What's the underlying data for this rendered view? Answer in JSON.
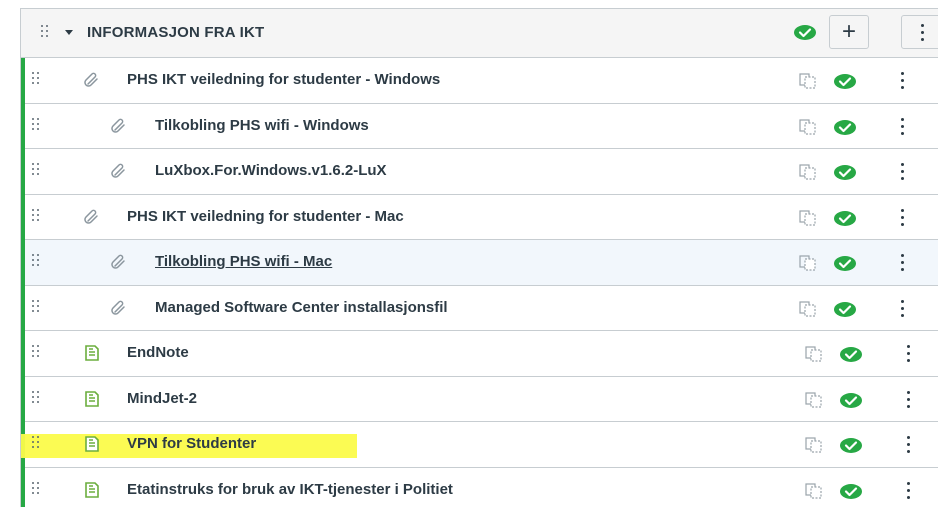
{
  "module": {
    "title": "INFORMASJON FRA IKT",
    "add_label": "+",
    "published": true
  },
  "items": [
    {
      "title": "PHS IKT veiledning for studenter - Windows",
      "type": "link",
      "indent": 0,
      "published": true,
      "link": false,
      "selected": false,
      "highlighted": false
    },
    {
      "title": "Tilkobling PHS wifi - Windows",
      "type": "link",
      "indent": 1,
      "published": true,
      "link": false,
      "selected": false,
      "highlighted": false
    },
    {
      "title": "LuXbox.For.Windows.v1.6.2-LuX",
      "type": "link",
      "indent": 1,
      "published": true,
      "link": false,
      "selected": false,
      "highlighted": false
    },
    {
      "title": "PHS IKT veiledning for studenter - Mac",
      "type": "link",
      "indent": 0,
      "published": true,
      "link": false,
      "selected": false,
      "highlighted": false
    },
    {
      "title": "Tilkobling PHS wifi - Mac",
      "type": "link",
      "indent": 1,
      "published": true,
      "link": true,
      "selected": true,
      "highlighted": false
    },
    {
      "title": "Managed Software Center installasjonsfil",
      "type": "link",
      "indent": 1,
      "published": true,
      "link": false,
      "selected": false,
      "highlighted": false
    },
    {
      "title": "EndNote",
      "type": "page",
      "indent": 0,
      "published": true,
      "link": false,
      "selected": false,
      "highlighted": false
    },
    {
      "title": "MindJet-2",
      "type": "page",
      "indent": 0,
      "published": true,
      "link": false,
      "selected": false,
      "highlighted": false
    },
    {
      "title": "VPN for Studenter",
      "type": "page",
      "indent": 0,
      "published": true,
      "link": false,
      "selected": false,
      "highlighted": true
    },
    {
      "title": "Etatinstruks for bruk av IKT-tjenester i Politiet",
      "type": "page",
      "indent": 0,
      "published": true,
      "link": false,
      "selected": false,
      "highlighted": false
    }
  ],
  "icons": {
    "drag": "drag-handle-icon",
    "link": "paperclip-icon",
    "page": "document-icon",
    "copy": "duplicate-icon",
    "published": "check-circle-icon",
    "menu": "kebab-menu-icon"
  },
  "colors": {
    "published_green": "#27a845",
    "page_icon_green": "#6cae3e",
    "highlight_yellow": "#fbfb4a",
    "selected_row": "#f2f7fc"
  }
}
